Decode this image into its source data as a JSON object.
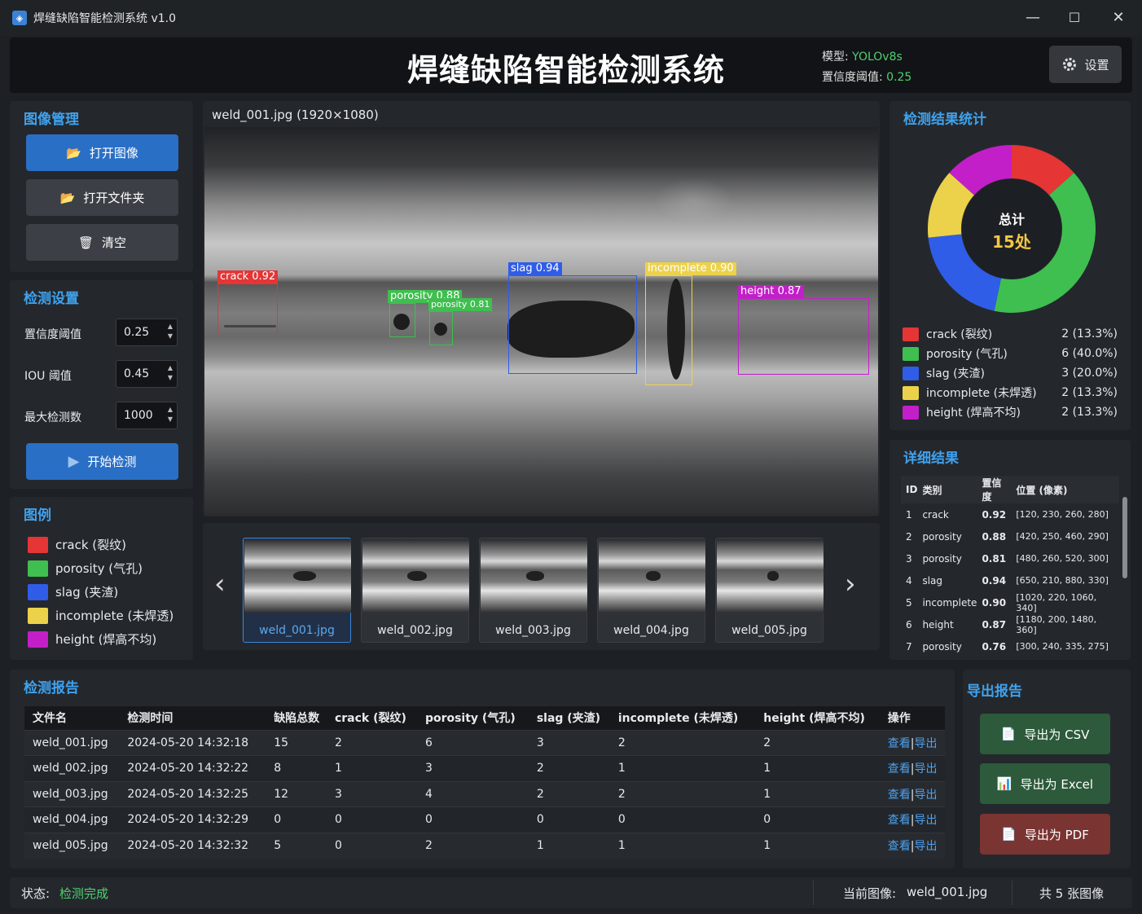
{
  "window": {
    "title": "焊缝缺陷智能检测系统 v1.0",
    "minimize": "—",
    "maximize": "☐",
    "close": "✕"
  },
  "header": {
    "title": "焊缝缺陷智能检测系统",
    "model_label": "模型:",
    "model_value": "YOLOv8s",
    "conf_label": "置信度阈值:",
    "conf_value": "0.25",
    "settings_label": "设置"
  },
  "image_mgmt": {
    "title": "图像管理",
    "open_image": "打开图像",
    "open_folder": "打开文件夹",
    "clear": "清空"
  },
  "detect_settings": {
    "title": "检测设置",
    "conf_label": "置信度阈值",
    "conf_value": "0.25",
    "iou_label": "IOU 阈值",
    "iou_value": "0.45",
    "max_label": "最大检测数",
    "max_value": "1000",
    "start": "开始检测"
  },
  "legend": {
    "title": "图例",
    "items": [
      {
        "label": "crack (裂纹)",
        "color": "#e53535"
      },
      {
        "label": "porosity (气孔)",
        "color": "#3fbf4f"
      },
      {
        "label": "slag (夹渣)",
        "color": "#2f5de8"
      },
      {
        "label": "incomplete (未焊透)",
        "color": "#ecd24a"
      },
      {
        "label": "height (焊高不均)",
        "color": "#c21fc9"
      }
    ]
  },
  "viewer": {
    "filename": "weld_001.jpg (1920×1080)",
    "detections": [
      {
        "label": "crack 0.92",
        "color": "#e53535"
      },
      {
        "label": "porosity 0.88",
        "color": "#3fbf4f"
      },
      {
        "label": "porosity 0.81",
        "color": "#3fbf4f"
      },
      {
        "label": "slag 0.94",
        "color": "#2f5de8"
      },
      {
        "label": "incomplete 0.90",
        "color": "#ecd24a"
      },
      {
        "label": "height 0.87",
        "color": "#c21fc9"
      }
    ]
  },
  "thumbnails": {
    "prev": "‹",
    "next": "›",
    "items": [
      "weld_001.jpg",
      "weld_002.jpg",
      "weld_003.jpg",
      "weld_004.jpg",
      "weld_005.jpg"
    ],
    "selected": 0
  },
  "stats": {
    "title": "检测结果统计",
    "total_label": "总计",
    "total_value": "15处",
    "rows": [
      {
        "label": "crack (裂纹)",
        "count": "2 (13.3%)",
        "color": "#e53535",
        "value": 2
      },
      {
        "label": "porosity (气孔)",
        "count": "6 (40.0%)",
        "color": "#3fbf4f",
        "value": 6
      },
      {
        "label": "slag (夹渣)",
        "count": "3 (20.0%)",
        "color": "#2f5de8",
        "value": 3
      },
      {
        "label": "incomplete (未焊透)",
        "count": "2 (13.3%)",
        "color": "#ecd24a",
        "value": 2
      },
      {
        "label": "height (焊高不均)",
        "count": "2 (13.3%)",
        "color": "#c21fc9",
        "value": 2
      }
    ]
  },
  "chart_data": {
    "type": "pie",
    "title": "",
    "categories": [
      "crack",
      "porosity",
      "slag",
      "incomplete",
      "height"
    ],
    "values": [
      2,
      6,
      3,
      2,
      2
    ],
    "colors": [
      "#e53535",
      "#3fbf4f",
      "#2f5de8",
      "#ecd24a",
      "#c21fc9"
    ]
  },
  "details": {
    "title": "详细结果",
    "headers": [
      "ID",
      "类别",
      "置信度",
      "位置 (像素)"
    ],
    "rows": [
      [
        "1",
        "crack",
        "0.92",
        "[120, 230, 260, 280]"
      ],
      [
        "2",
        "porosity",
        "0.88",
        "[420, 250, 460, 290]"
      ],
      [
        "3",
        "porosity",
        "0.81",
        "[480, 260, 520, 300]"
      ],
      [
        "4",
        "slag",
        "0.94",
        "[650, 210, 880, 330]"
      ],
      [
        "5",
        "incomplete",
        "0.90",
        "[1020, 220, 1060, 340]"
      ],
      [
        "6",
        "height",
        "0.87",
        "[1180, 200, 1480, 360]"
      ],
      [
        "7",
        "porosity",
        "0.76",
        "[300, 240, 335, 275]"
      ]
    ]
  },
  "report": {
    "title": "检测报告",
    "headers": [
      "文件名",
      "检测时间",
      "缺陷总数",
      "crack (裂纹)",
      "porosity (气孔)",
      "slag (夹渣)",
      "incomplete (未焊透)",
      "height (焊高不均)",
      "操作"
    ],
    "view": "查看",
    "export": "导出",
    "sep": "|",
    "rows": [
      [
        "weld_001.jpg",
        "2024-05-20 14:32:18",
        "15",
        "2",
        "6",
        "3",
        "2",
        "2"
      ],
      [
        "weld_002.jpg",
        "2024-05-20 14:32:22",
        "8",
        "1",
        "3",
        "2",
        "1",
        "1"
      ],
      [
        "weld_003.jpg",
        "2024-05-20 14:32:25",
        "12",
        "3",
        "4",
        "2",
        "2",
        "1"
      ],
      [
        "weld_004.jpg",
        "2024-05-20 14:32:29",
        "0",
        "0",
        "0",
        "0",
        "0",
        "0"
      ],
      [
        "weld_005.jpg",
        "2024-05-20 14:32:32",
        "5",
        "0",
        "2",
        "1",
        "1",
        "1"
      ]
    ]
  },
  "export": {
    "title": "导出报告",
    "csv": "导出为 CSV",
    "excel": "导出为 Excel",
    "pdf": "导出为 PDF"
  },
  "status": {
    "label": "状态:",
    "value": "检测完成",
    "current_label": "当前图像:",
    "current_value": "weld_001.jpg",
    "count": "共 5 张图像"
  }
}
